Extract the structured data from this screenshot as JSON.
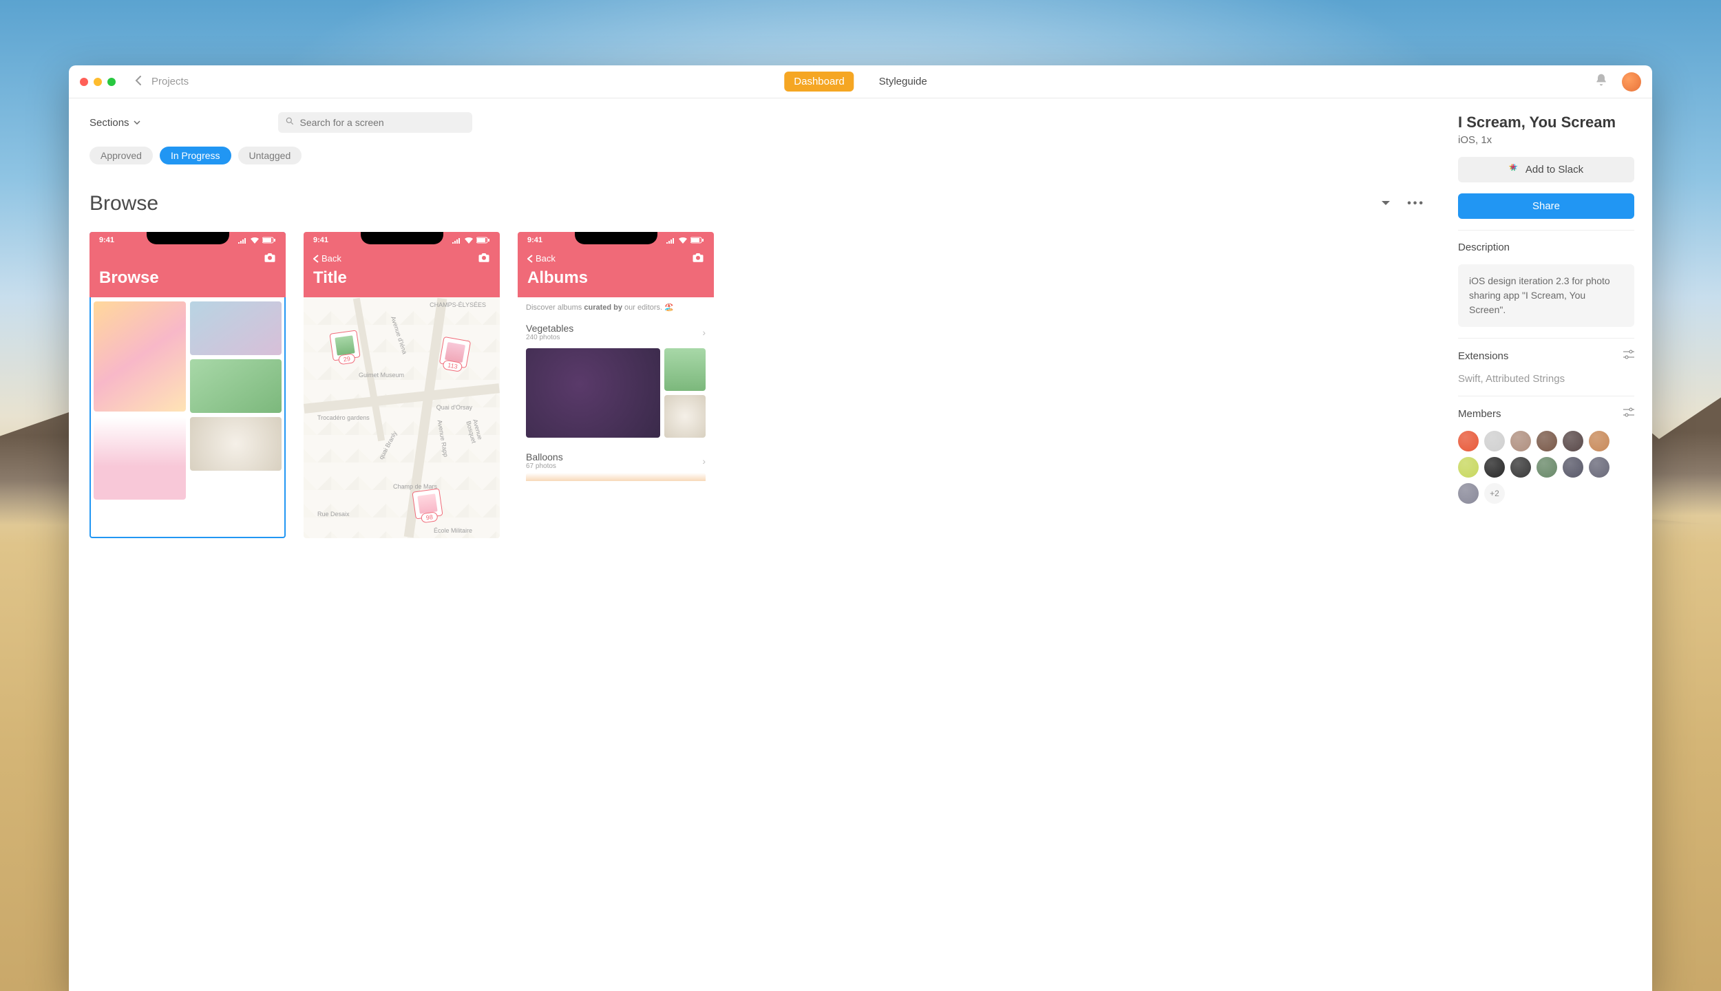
{
  "titlebar": {
    "breadcrumb": "Projects",
    "tabs": {
      "dashboard": "Dashboard",
      "styleguide": "Styleguide"
    }
  },
  "toolbar": {
    "sections_label": "Sections",
    "search_placeholder": "Search for a screen"
  },
  "tags": {
    "approved": "Approved",
    "in_progress": "In Progress",
    "untagged": "Untagged"
  },
  "section": {
    "title": "Browse"
  },
  "screens": [
    {
      "time": "9:41",
      "title": "Browse"
    },
    {
      "time": "9:41",
      "back": "Back",
      "title": "Title",
      "map_pins": [
        "29",
        "113",
        "98"
      ],
      "map_labels": [
        "CHAMPS-ÉLYSÉES",
        "Guimet Museum",
        "Quai d'Orsay",
        "Trocadéro gardens",
        "Champ de Mars",
        "École Militaire",
        "Rue Desaix",
        "quai Branly",
        "Avenue Rapp",
        "Avenue Bosquet",
        "Avenue d'Iéna"
      ]
    },
    {
      "time": "9:41",
      "back": "Back",
      "title": "Albums",
      "discover_pre": "Discover albums ",
      "discover_bold": "curated by",
      "discover_post": " our editors. 🏖️",
      "albums": [
        {
          "name": "Vegetables",
          "sub": "240 photos"
        },
        {
          "name": "Balloons",
          "sub": "67 photos"
        }
      ]
    }
  ],
  "sidebar": {
    "project_name": "I Scream, You Scream",
    "project_meta": "iOS, 1x",
    "add_to_slack": "Add to Slack",
    "share": "Share",
    "description_hdr": "Description",
    "description_body": "iOS design iteration 2.3 for photo sharing app \"I Scream, You Screen\".",
    "extensions_hdr": "Extensions",
    "extensions_body": "Swift, Attributed Strings",
    "members_hdr": "Members",
    "members_more": "+2",
    "member_colors": [
      "#e85a3a",
      "#d0d0d0",
      "#b09080",
      "#7a5a4a",
      "#5a4a4a",
      "#c88a5a",
      "#c8d860",
      "#2a2a2a",
      "#3a3a3a",
      "#6a8a6a",
      "#5a5a6a",
      "#6a6a7a",
      "#8a8a9a"
    ]
  }
}
